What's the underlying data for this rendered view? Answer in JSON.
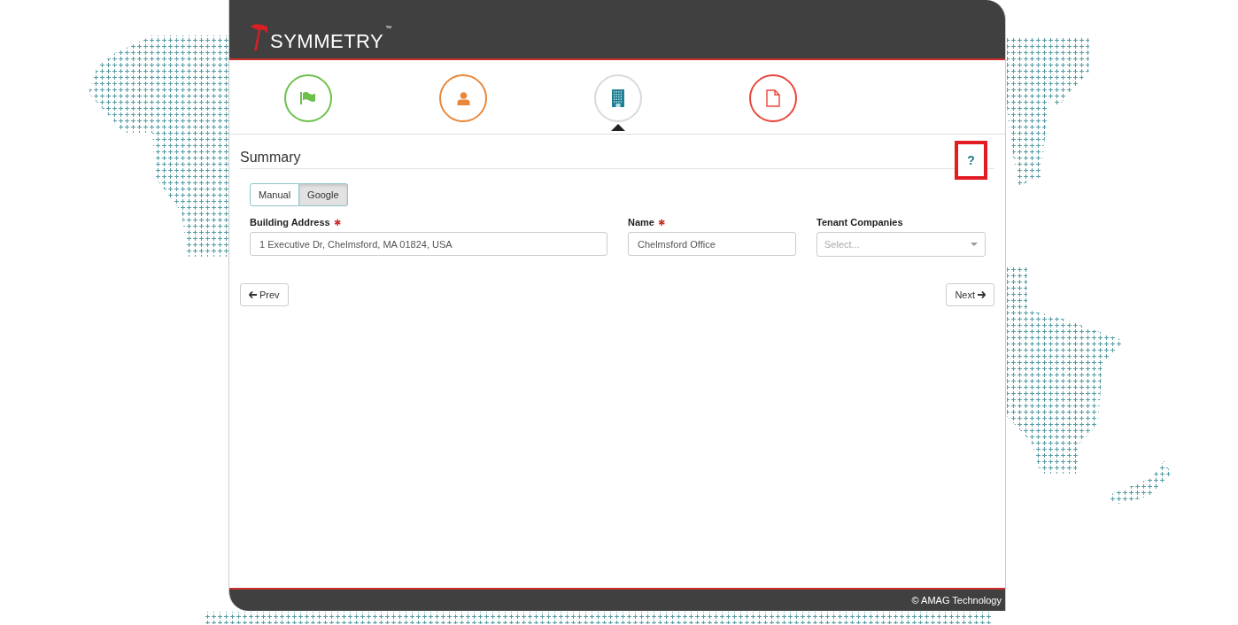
{
  "header": {
    "logo": "SYMMETRY",
    "trademark": "™"
  },
  "steps": [
    {
      "kind": "flag",
      "color": "#6cc04a",
      "selected": false
    },
    {
      "kind": "person",
      "color": "#e8883a",
      "selected": false
    },
    {
      "kind": "building",
      "color": "#1f7f93",
      "selected": true
    },
    {
      "kind": "document",
      "color": "#e8453c",
      "selected": false
    }
  ],
  "section": {
    "title": "Summary",
    "help": "?"
  },
  "mode_toggle": [
    {
      "label": "Manual",
      "selected": false
    },
    {
      "label": "Google",
      "selected": true
    }
  ],
  "fields": [
    {
      "kind": "text",
      "label": "Building Address",
      "required_mark": "✱",
      "value": "1 Executive Dr, Chelmsford, MA 01824, USA"
    },
    {
      "kind": "text",
      "label": "Name",
      "required_mark": "✱",
      "value": "Chelmsford Office"
    },
    {
      "kind": "select",
      "label": "Tenant Companies",
      "placeholder": "Select..."
    }
  ],
  "nav": {
    "prev": "Prev",
    "next": "Next"
  },
  "footer": {
    "copyright": "© AMAG Technology"
  }
}
